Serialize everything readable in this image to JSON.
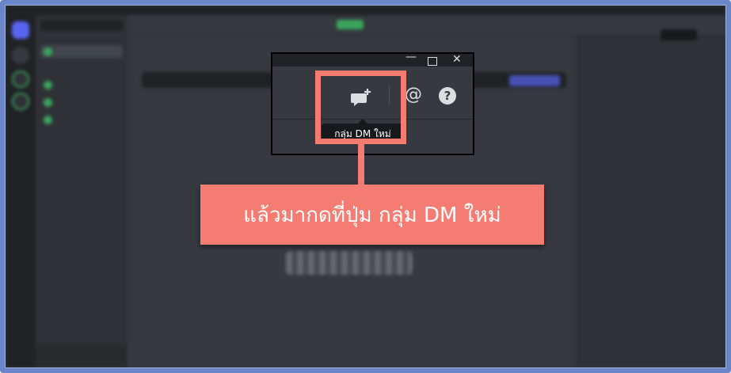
{
  "annotation": {
    "callout_text": "แล้วมากดที่ปุ่ม กลุ่ม DM ใหม่",
    "highlight_color": "#f47c72",
    "frame_color": "#6a86c9"
  },
  "zoom_panel": {
    "window_controls": {
      "minimize": "—",
      "close": "✕"
    },
    "new_dm_icon": "chat-plus-icon",
    "at_symbol": "@",
    "help_symbol": "?",
    "tooltip": "กลุ่ม DM ใหม่"
  },
  "colors": {
    "app_bg": "#36393f",
    "sidebar_bg": "#2f3136",
    "rail_bg": "#202225",
    "tooltip_bg": "#18191c",
    "brand": "#5865f2",
    "online_green": "#3ba55d"
  }
}
